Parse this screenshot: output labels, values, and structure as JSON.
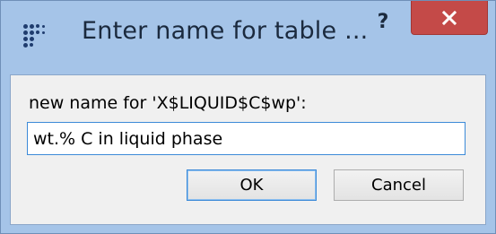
{
  "dialog": {
    "title": "Enter name for table ...",
    "help_label": "?",
    "close_label": "×",
    "prompt": "new name for 'X$LIQUID$C$wp':",
    "input_value": "wt.% C in liquid phase",
    "ok_label": "OK",
    "cancel_label": "Cancel"
  },
  "icons": {
    "app": "app-dots-icon",
    "close": "close-icon"
  },
  "colors": {
    "frame": "#a5c4e8",
    "close_button": "#c44a48",
    "client": "#f0f0f0",
    "focus_border": "#3c8ad8"
  }
}
